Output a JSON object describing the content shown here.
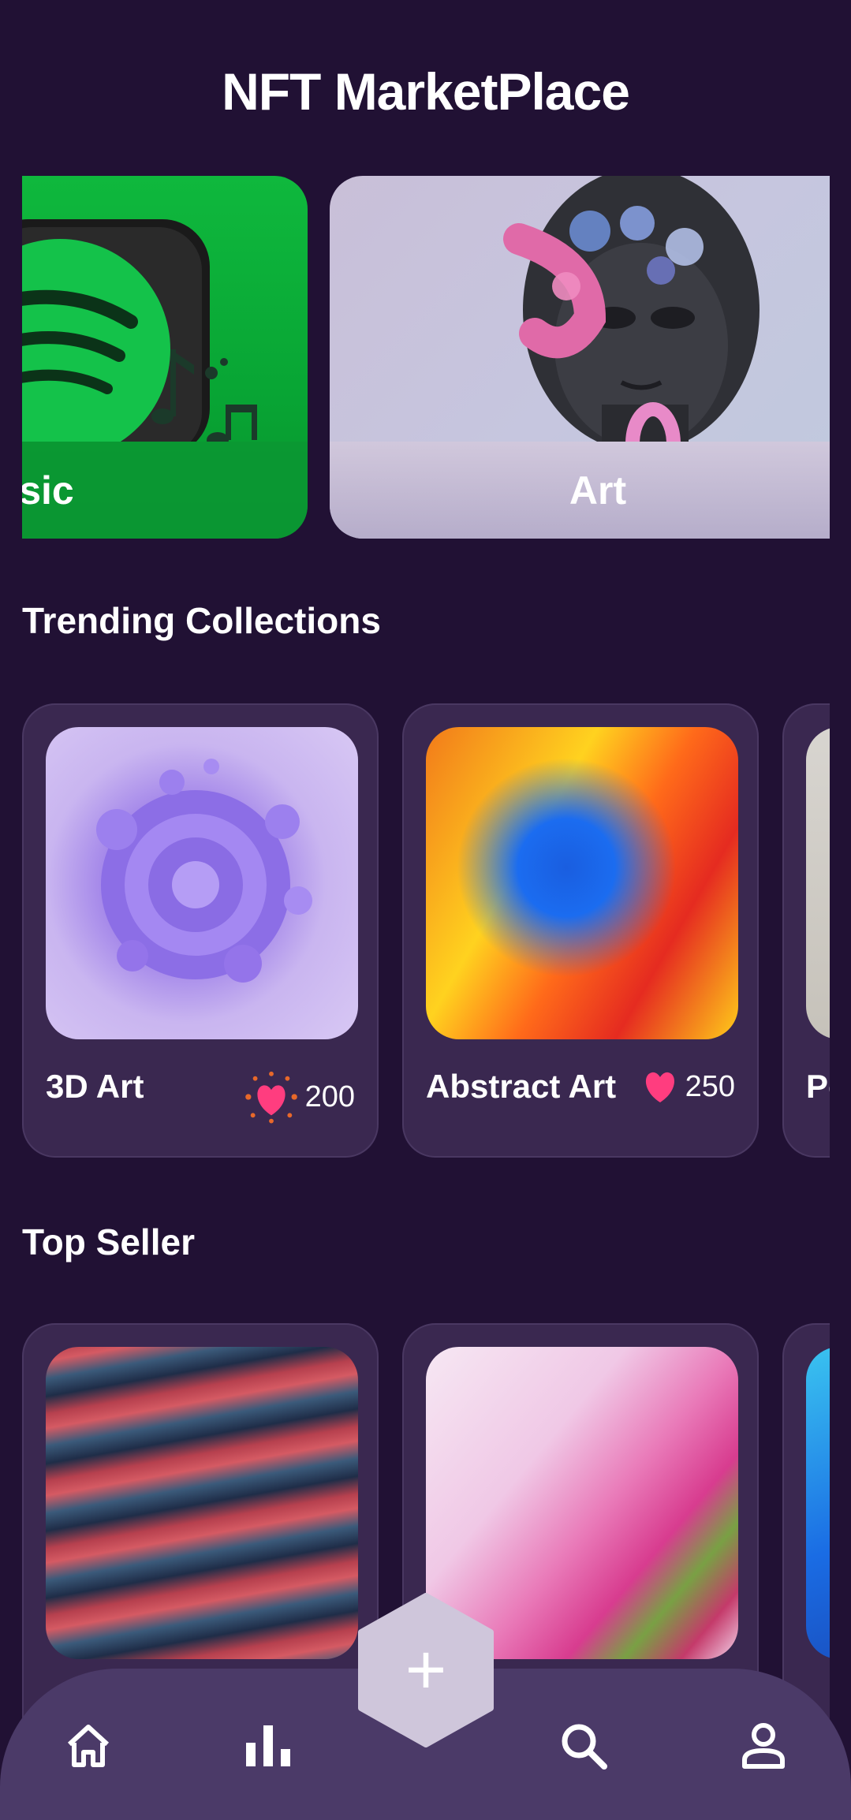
{
  "header": {
    "title": "NFT MarketPlace"
  },
  "categories": [
    {
      "label": "Music"
    },
    {
      "label": "Art"
    }
  ],
  "trending": {
    "title": "Trending Collections",
    "items": [
      {
        "name": "3D Art",
        "likes": "200"
      },
      {
        "name": "Abstract Art",
        "likes": "250"
      },
      {
        "name": "Po"
      }
    ]
  },
  "top_seller": {
    "title": "Top Seller"
  },
  "nav": {
    "items": [
      "home-icon",
      "chart-icon",
      "add-icon",
      "search-icon",
      "profile-icon"
    ],
    "add_label": "+"
  },
  "colors": {
    "background": "#211134",
    "card": "#3a2850",
    "nav": "#4b3a68",
    "heart": "#ff3d7f"
  }
}
